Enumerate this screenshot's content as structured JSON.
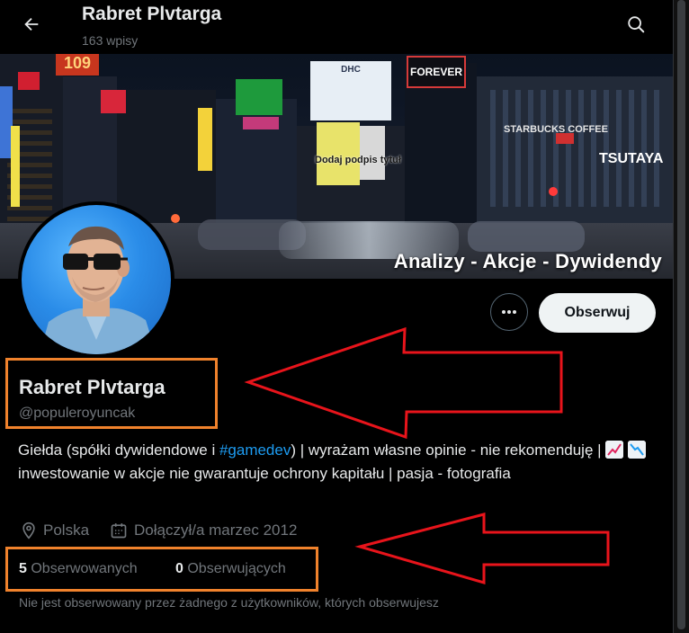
{
  "header": {
    "title": "Rabret Plvtarga",
    "post_count": "163 wpisy",
    "back_icon": "arrow-left-icon",
    "search_icon": "search-icon"
  },
  "banner": {
    "caption": "Analizy - Akcje - Dywidendy",
    "signs": [
      "109",
      "FOREVER",
      "DHC",
      "STARBUCKS COFFEE",
      "TSUTAYA",
      "Dodaj podpis tytuł"
    ]
  },
  "actions": {
    "more_icon": "more-horizontal-icon",
    "follow_label": "Obserwuj"
  },
  "profile": {
    "display_name": "Rabret Plvtarga",
    "handle": "@populeroyuncak",
    "bio_part1": "Giełda (spółki dywidendowe i ",
    "bio_hashtag": "#gamedev",
    "bio_part2": ") | wyrażam własne opinie - nie rekomenduję | ",
    "bio_part3": "inwestowanie w akcje nie gwarantuje ochrony kapitału | pasja - fotografia",
    "location": "Polska",
    "joined": "Dołączył/a marzec 2012",
    "following_count": "5",
    "following_label": "Obserwowanych",
    "followers_count": "0",
    "followers_label": "Obserwujących",
    "followed_by_note": "Nie jest obserwowany przez żadnego z użytkowników, których obserwujesz"
  },
  "colors": {
    "background": "#000000",
    "text_primary": "#e7e9ea",
    "text_secondary": "#71767b",
    "link": "#1d9bf0",
    "annotation_box": "#f0822c",
    "annotation_arrow": "#e8141b"
  }
}
